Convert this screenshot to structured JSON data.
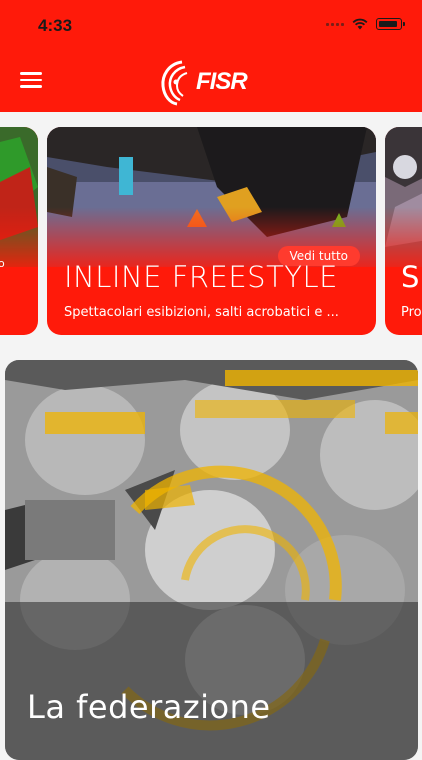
{
  "status_bar": {
    "time": "4:33"
  },
  "header": {
    "logo_text": "FISR"
  },
  "carousel": {
    "left_card": {
      "pill": "o"
    },
    "main_card": {
      "title": "INLINE FREESTYLE",
      "description": "Spettacolari esibizioni, salti acrobatici e ...",
      "pill": "Vedi tutto"
    },
    "right_card": {
      "title": "S",
      "description": "Pro"
    }
  },
  "feature": {
    "title": "La federazione"
  },
  "colors": {
    "brand": "#ff1a0a",
    "accent_yellow": "#f0b400"
  }
}
